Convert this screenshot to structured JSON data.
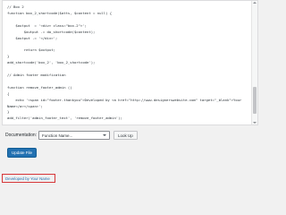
{
  "editor": {
    "code": "// Box 2\nfunction box_2_shortcode($atts, $content = null) {\n\n    $output  = '<div> class=\"box-2\">';\n        $output .= do_shortcode($content);\n    $output .= '</div>';\n\n        return $output;\n}\nadd_shortcode('box_2', 'box_2_shortcode');\n\n// Admin footer modification\n\nfunction remove_footer_admin ()\n{\n    echo '<span id=\"footer-thankyou\">Developed by <a href=\"http://www.designerswebsite.com\" target=\"_blank\">Your\nName</a></span>';\n}\nadd_filter('admin_footer_text', 'remove_footer_admin');\n\n\n?>"
  },
  "documentation": {
    "label": "Documentation:",
    "select_value": "Function Name...",
    "lookup_label": "Look Up"
  },
  "update_button_label": "Update File",
  "footer": {
    "link_text": "Developed by Your Name"
  },
  "colors": {
    "primary": "#2271b1",
    "highlight_border": "#d63638",
    "background": "#f1f1f1"
  }
}
